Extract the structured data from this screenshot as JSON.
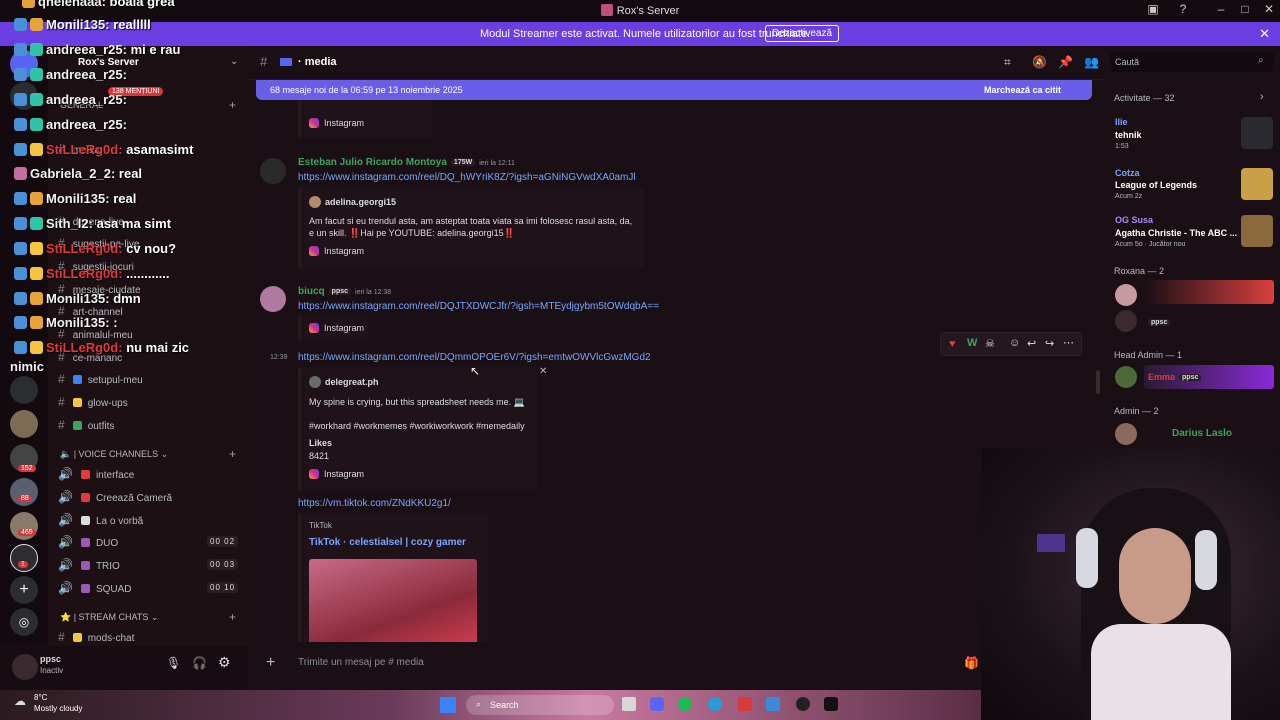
{
  "window": {
    "title": "Rox's Server"
  },
  "banner": {
    "text": "Modul Streamer este activat. Numele utilizatorilor au fost trunchiate.",
    "button": "Dezactivează"
  },
  "server": {
    "name": "Rox's Server",
    "mentions": "138 MENȚIUNI"
  },
  "rail_badges": [
    "152",
    "88",
    "469",
    "1"
  ],
  "channels": {
    "general_label": "GENERAL",
    "text": [
      {
        "name": "media"
      },
      {
        "name": "desene-live"
      },
      {
        "name": "sugestii-pe-live"
      },
      {
        "name": "sugestii-jocuri"
      },
      {
        "name": "mesaje-ciudate"
      },
      {
        "name": "art-channel"
      },
      {
        "name": "animalul-meu"
      },
      {
        "name": "ce-mananc"
      },
      {
        "name": "setupul-meu"
      },
      {
        "name": "glow-ups"
      },
      {
        "name": "outfits"
      }
    ],
    "voice_label": "VOICE CHANNELS",
    "voice": [
      {
        "name": "interface"
      },
      {
        "name": "Creează Cameră"
      },
      {
        "name": "La o vorbă"
      },
      {
        "name": "DUO",
        "count": "00 02"
      },
      {
        "name": "TRIO",
        "count": "00 03"
      },
      {
        "name": "SQUAD",
        "count": "00 10"
      }
    ],
    "stream_label": "STREAM CHATS",
    "stream": [
      {
        "name": "mods-chat"
      }
    ]
  },
  "overlay_chat": [
    {
      "name": "qhelenaaa:",
      "msg": "boala grea",
      "red": false
    },
    {
      "name": "Monili135:",
      "msg": "realllll",
      "red": false
    },
    {
      "name": "andreea_r25:",
      "msg": "mi e rau",
      "red": false
    },
    {
      "name": "andreea_r25:",
      "msg": "",
      "red": false
    },
    {
      "name": "andreea_r25:",
      "msg": "",
      "red": false
    },
    {
      "name": "andreea_r25:",
      "msg": "",
      "red": false
    },
    {
      "name": "StiLLeRg0d:",
      "msg": "asamasimt",
      "red": true
    },
    {
      "name": "Gabriela_2_2:",
      "msg": "real",
      "red": false
    },
    {
      "name": "Monili135:",
      "msg": "real",
      "red": false
    },
    {
      "name": "Sith_l2:",
      "msg": "asa ma simt",
      "red": false
    },
    {
      "name": "StiLLeRg0d:",
      "msg": "cv nou?",
      "red": true
    },
    {
      "name": "StiLLeRg0d:",
      "msg": "............",
      "red": true
    },
    {
      "name": "Monili135:",
      "msg": "dmn",
      "red": false
    },
    {
      "name": "Monili135:",
      "msg": ":",
      "red": false
    },
    {
      "name": "StiLLeRg0d:",
      "msg": "nu mai zic",
      "red": true
    },
    {
      "name": "nimic",
      "msg": "",
      "red": false
    }
  ],
  "user": {
    "name": "ppsc",
    "status": "Inactiv"
  },
  "chat_header": {
    "channel": "media"
  },
  "new_messages": {
    "text": "68 mesaje noi de la 06:59 pe 13 noiembrie 2025",
    "action": "Marchează ca citit"
  },
  "messages": [
    {
      "embed_footer": "Instagram"
    },
    {
      "author": "Esteban Julio Ricardo Montoya",
      "tag": "175W",
      "time": "ieri la 12:11",
      "link": "https://www.instagram.com/reel/DQ_hWYriK8Z/?igsh=aGNiNGVwdXA0amJl",
      "embed_author": "adelina.georgi15",
      "embed_text_1": "Am facut si eu trendul asta, am asteptat toata viata sa imi folosesc rasul asta, da,",
      "embed_text_2": "e un skill. ‼️Hai pe YOUTUBE: adelina.georgi15‼️",
      "embed_footer": "Instagram"
    },
    {
      "author": "biucq",
      "tag": "ppsc",
      "time": "ieri la 12:38",
      "link": "https://www.instagram.com/reel/DQJTXDWCJfr/?igsh=MTEydjgybm5tOWdqbA==",
      "embed_footer": "Instagram"
    },
    {
      "time_side": "12:39",
      "link": "https://www.instagram.com/reel/DQmmOPOEr6V/?igsh=emtwOWVlcGwzMGd2",
      "embed_author": "delegreat.ph",
      "embed_text_1": "My spine is crying, but this spreadsheet needs me. 💻",
      "embed_text_2": "#workhard #workmemes #workiworkwork #memedaily",
      "likes_label": "Likes",
      "likes": "8421",
      "embed_footer": "Instagram"
    },
    {
      "link": "https://vm.tiktok.com/ZNdKKU2g1/",
      "embed_provider": "TikTok",
      "embed_title": "TikTok · celestialsel | cozy gamer"
    }
  ],
  "composer": {
    "placeholder": "Trimite un mesaj pe # media"
  },
  "search": {
    "placeholder": "Caută"
  },
  "activity": {
    "header": "Activitate — 32",
    "items": [
      {
        "name": "Ilie",
        "game": "tehnik",
        "sub": "1:53"
      },
      {
        "name": "Cotza",
        "game": "League of Legends",
        "sub": "Acum 2z"
      },
      {
        "name": "OG Susa",
        "game": "Agatha Christie - The ABC ...",
        "sub": "Acum 5o · Jucător nou"
      }
    ],
    "roxana_header": "Roxana — 2",
    "roxana_members": [
      "ppsc"
    ],
    "headadmin_header": "Head Admin — 1",
    "headadmin_members": [
      "Emma",
      "ppsc"
    ],
    "admin_header": "Admin — 2",
    "admin_members": [
      "Darius Laslo"
    ]
  },
  "taskbar": {
    "weather_temp": "8°C",
    "weather_desc": "Mostly cloudy",
    "search": "Search"
  },
  "colors": {
    "accent": "#6a3ee0",
    "link": "#7aa6ff",
    "green": "#3ba55d",
    "red": "#e03a3a"
  }
}
